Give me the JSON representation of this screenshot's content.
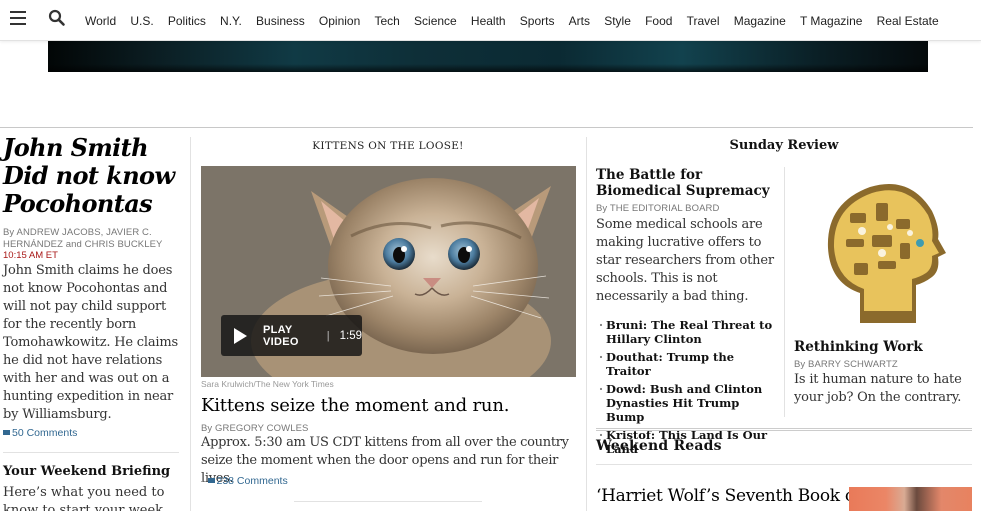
{
  "nav": {
    "items": [
      "World",
      "U.S.",
      "Politics",
      "N.Y.",
      "Business",
      "Opinion",
      "Tech",
      "Science",
      "Health",
      "Sports",
      "Arts",
      "Style",
      "Food",
      "Travel",
      "Magazine",
      "T Magazine",
      "Real Estate"
    ]
  },
  "lead": {
    "headline": "John Smith Did not know Pocohontas",
    "byline": "By ANDREW JACOBS, JAVIER C. HERNÁNDEZ and CHRIS BUCKLEY",
    "time": "10:15 AM ET",
    "summary": "John Smith claims he does not know Pocohontas and will not pay child support for the recently born Tomohawkowitz. He claims he did not have relations with her and was out on a hunting expedition in near by Williamsburg.",
    "comments": "50 Comments"
  },
  "briefing": {
    "title": "Your Weekend Briefing",
    "summary": "Here’s what you need to know to start your week."
  },
  "feature": {
    "kicker": "KITTENS ON THE LOOSE!",
    "play_label": "PLAY VIDEO",
    "duration": "1:59",
    "credit": "Sara Krulwich/The New York Times",
    "headline": "Kittens seize the moment and run.",
    "byline": "By GREGORY COWLES",
    "summary": "Approx. 5:30 am US CDT kittens from all over the country seize the moment when the door opens and run for their lives.",
    "comments": "238 Comments"
  },
  "sunday_review": {
    "section": "Sunday Review",
    "headline": "The Battle for Biomedical Supremacy",
    "byline": "By THE EDITORIAL BOARD",
    "summary": "Some medical schools are making lucrative offers to star researchers from other schools. This is not necessarily a bad thing.",
    "links": [
      "Bruni: The Real Threat to Hillary Clinton",
      "Douthat: Trump the Traitor",
      "Dowd: Bush and Clinton Dynasties Hit Trump Bump",
      "Kristof: This Land Is Our Land"
    ],
    "side_title": "Rethinking Work",
    "side_byline": "By BARRY SCHWARTZ",
    "side_summary": "Is it human nature to hate your job? On the contrary."
  },
  "weekend_reads": {
    "section": "Weekend Reads",
    "story": "‘Harriet Wolf’s Seventh Book of"
  }
}
